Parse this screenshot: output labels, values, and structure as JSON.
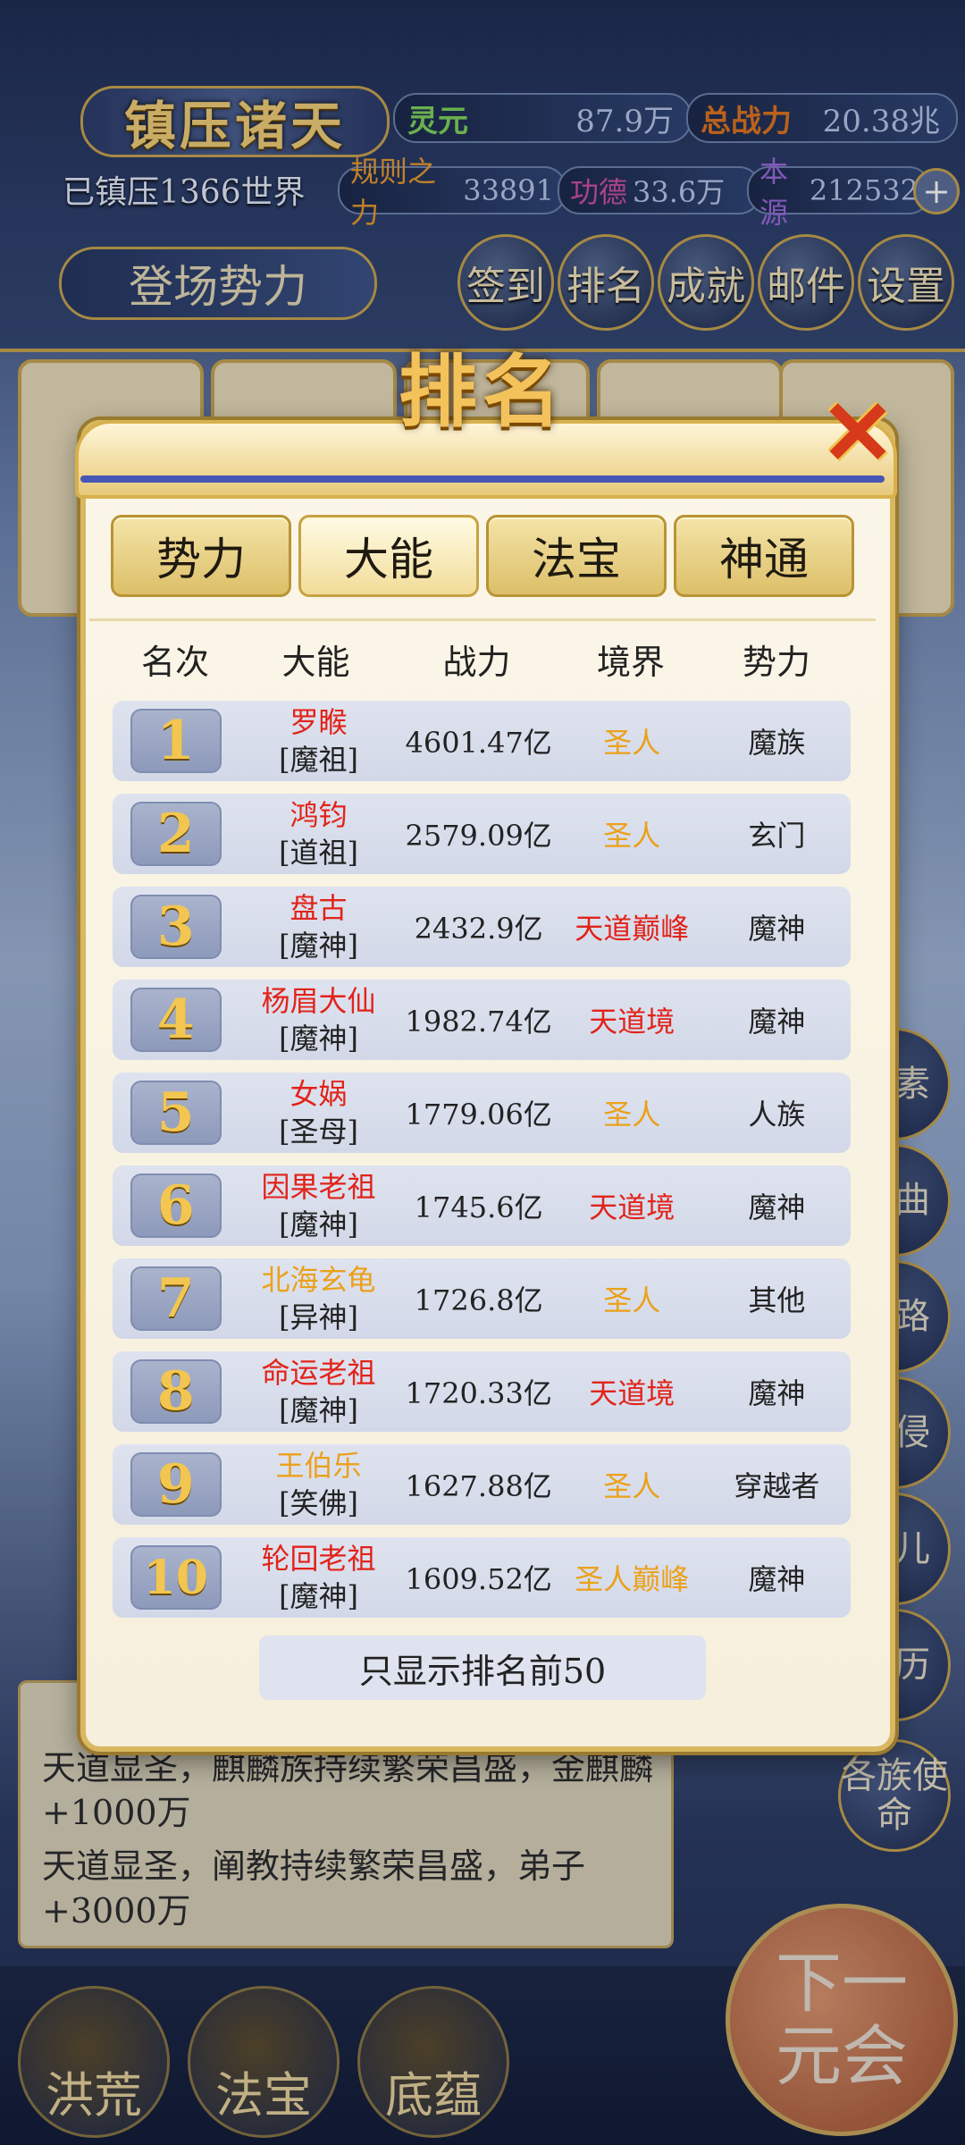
{
  "hud": {
    "title": "镇压诸天",
    "lingyuan_label": "灵元",
    "lingyuan_value": "87.9万",
    "total_power_label": "总战力",
    "total_power_value": "20.38兆",
    "suppressed": "已镇压1366世界",
    "rule_label": "规则之力",
    "rule_value": "33891",
    "merit_label": "功德",
    "merit_value": "33.6万",
    "origin_label": "本源",
    "origin_value": "212532",
    "faction_button": "登场势力",
    "top_icons": [
      "签到",
      "排名",
      "成就",
      "邮件",
      "设置"
    ]
  },
  "background": {
    "side_icons": [
      "元素",
      "暗曲",
      "道路",
      "域侵",
      "道儿",
      "身历",
      "各族使命"
    ],
    "log_lines": [
      "天道显圣，麒麟族持续繁荣昌盛，金麒麟+1000万",
      "天道显圣，阐教持续繁荣昌盛，弟子+3000万"
    ],
    "bottom_buttons": [
      "洪荒",
      "法宝",
      "底蕴"
    ],
    "next_button": "下一元会"
  },
  "modal": {
    "title": "排名",
    "tabs": [
      "势力",
      "大能",
      "法宝",
      "神通"
    ],
    "active_tab": "大能",
    "headers": [
      "名次",
      "大能",
      "战力",
      "境界",
      "势力"
    ],
    "rows": [
      {
        "rank": "1",
        "name": "罗睺",
        "title": "[魔祖]",
        "power": "4601.47亿",
        "realm": "圣人",
        "faction": "魔族",
        "name_color": "#e2231a",
        "realm_color": "#eba11a"
      },
      {
        "rank": "2",
        "name": "鸿钧",
        "title": "[道祖]",
        "power": "2579.09亿",
        "realm": "圣人",
        "faction": "玄门",
        "name_color": "#e2231a",
        "realm_color": "#eba11a"
      },
      {
        "rank": "3",
        "name": "盘古",
        "title": "[魔神]",
        "power": "2432.9亿",
        "realm": "天道巅峰",
        "faction": "魔神",
        "name_color": "#e2231a",
        "realm_color": "#e2231a"
      },
      {
        "rank": "4",
        "name": "杨眉大仙",
        "title": "[魔神]",
        "power": "1982.74亿",
        "realm": "天道境",
        "faction": "魔神",
        "name_color": "#e2231a",
        "realm_color": "#e2231a"
      },
      {
        "rank": "5",
        "name": "女娲",
        "title": "[圣母]",
        "power": "1779.06亿",
        "realm": "圣人",
        "faction": "人族",
        "name_color": "#e2231a",
        "realm_color": "#eba11a"
      },
      {
        "rank": "6",
        "name": "因果老祖",
        "title": "[魔神]",
        "power": "1745.6亿",
        "realm": "天道境",
        "faction": "魔神",
        "name_color": "#e2231a",
        "realm_color": "#e2231a"
      },
      {
        "rank": "7",
        "name": "北海玄龟",
        "title": "[异神]",
        "power": "1726.8亿",
        "realm": "圣人",
        "faction": "其他",
        "name_color": "#eba11a",
        "realm_color": "#eba11a"
      },
      {
        "rank": "8",
        "name": "命运老祖",
        "title": "[魔神]",
        "power": "1720.33亿",
        "realm": "天道境",
        "faction": "魔神",
        "name_color": "#e2231a",
        "realm_color": "#e2231a"
      },
      {
        "rank": "9",
        "name": "王伯乐",
        "title": "[笑佛]",
        "power": "1627.88亿",
        "realm": "圣人",
        "faction": "穿越者",
        "name_color": "#eba11a",
        "realm_color": "#eba11a"
      },
      {
        "rank": "10",
        "name": "轮回老祖",
        "title": "[魔神]",
        "power": "1609.52亿",
        "realm": "圣人巅峰",
        "faction": "魔神",
        "name_color": "#e2231a",
        "realm_color": "#eba11a"
      }
    ],
    "footer_note": "只显示排名前50"
  }
}
